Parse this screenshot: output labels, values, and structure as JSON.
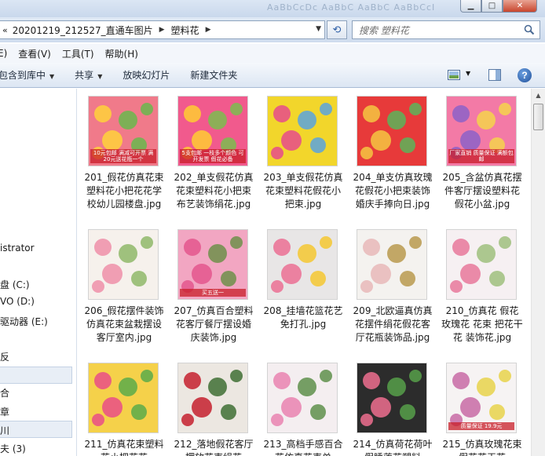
{
  "window": {
    "title_blur_text": "AaBbCcDc AaBbC AaBbC AaBbCcI",
    "controls": [
      "minimize",
      "maximize",
      "close"
    ]
  },
  "address": {
    "chevron": "«",
    "segments": [
      "20201219_212527_直通车图片",
      "塑料花"
    ],
    "search_placeholder": "搜索 塑料花"
  },
  "menu": [
    "E)",
    "查看(V)",
    "工具(T)",
    "帮助(H)"
  ],
  "commands": [
    {
      "label": "包含到库中",
      "dropdown": true
    },
    {
      "label": "共享",
      "dropdown": true
    },
    {
      "label": "放映幻灯片",
      "dropdown": false
    },
    {
      "label": "新建文件夹",
      "dropdown": false
    }
  ],
  "nav": {
    "items": [
      "istrator",
      "盘 (C:)",
      "VO (D:)",
      "驱动器 (E:)",
      "反",
      "合",
      "章",
      "川",
      "夫 (3)"
    ]
  },
  "files": [
    {
      "name": "201_假花仿真花束塑料花小把花花学校幼儿园楼盘.jpg",
      "thumb_label": "10元包邮 满减可开票 满20元送花瓶一个",
      "palette": [
        "#f07a8a",
        "#ffd23a",
        "#69b84c"
      ]
    },
    {
      "name": "202_单支假花仿真花束塑料花小把束布艺装饰绢花.jpg",
      "thumb_label": "5支包邮 一枝多个颜色 可开发票 假花必备",
      "palette": [
        "#f15a8d",
        "#ffcc33",
        "#7bbd4f"
      ]
    },
    {
      "name": "203_单支假花仿真花束塑料花假花小把束.jpg",
      "thumb_label": "",
      "palette": [
        "#f2d62b",
        "#e64b8c",
        "#5aa3df"
      ]
    },
    {
      "name": "204_单支仿真玫瑰花假花小把束装饰婚庆手捧向日.jpg",
      "thumb_label": "",
      "palette": [
        "#e73a3a",
        "#f4c742",
        "#5bb55b"
      ]
    },
    {
      "name": "205_含盆仿真花摆件客厅摆设塑料花假花小盆.jpg",
      "thumb_label": "厂家直销 质量保证 满额包邮",
      "palette": [
        "#f37aa6",
        "#8c61c8",
        "#f5d34b"
      ]
    },
    {
      "name": "206_假花摆件装饰仿真花束盆栽摆设客厅室内.jpg",
      "thumb_label": "",
      "palette": [
        "#f6f1ec",
        "#ee8fa9",
        "#8fb86a"
      ]
    },
    {
      "name": "207_仿真百合塑料花客厅餐厅摆设婚庆装饰.jpg",
      "thumb_label": "买五送一",
      "palette": [
        "#f2a6c2",
        "#e4568d",
        "#6f8f4a"
      ]
    },
    {
      "name": "208_挂墙花篮花艺 免打孔.jpg",
      "thumb_label": "",
      "palette": [
        "#e8e6e6",
        "#eb6f93",
        "#f4c730"
      ]
    },
    {
      "name": "209_北欧逼真仿真花摆件绢花假花客厅花瓶装饰品.jpg",
      "thumb_label": "",
      "palette": [
        "#f4f2ef",
        "#e7b8b9",
        "#b89a4d"
      ]
    },
    {
      "name": "210_仿真花 假花玫瑰花 花束 把花干花 装饰花.jpg",
      "thumb_label": "",
      "palette": [
        "#f6f0f2",
        "#e8789b",
        "#9fbf7e"
      ]
    },
    {
      "name": "211_仿真花束塑料花小把花花",
      "thumb_label": "",
      "palette": [
        "#f5d14a",
        "#e94e87",
        "#5bab4a"
      ]
    },
    {
      "name": "212_落地假花客厅摆放花束绢花",
      "thumb_label": "",
      "palette": [
        "#ece7e1",
        "#c6202e",
        "#3f6e34"
      ]
    },
    {
      "name": "213_高档手感百合花仿真花束单",
      "thumb_label": "",
      "palette": [
        "#f4eef0",
        "#e983b0",
        "#5e8f4b"
      ]
    },
    {
      "name": "214_仿真荷花荷叶假睡莲花塑料",
      "thumb_label": "",
      "palette": [
        "#2c2c2c",
        "#ef6f8f",
        "#57a04a"
      ]
    },
    {
      "name": "215_仿真玫瑰花束假花花干花",
      "thumb_label": "质量保证 19.9元",
      "palette": [
        "#f6f3f3",
        "#c86aa5",
        "#e7d24a"
      ]
    }
  ]
}
